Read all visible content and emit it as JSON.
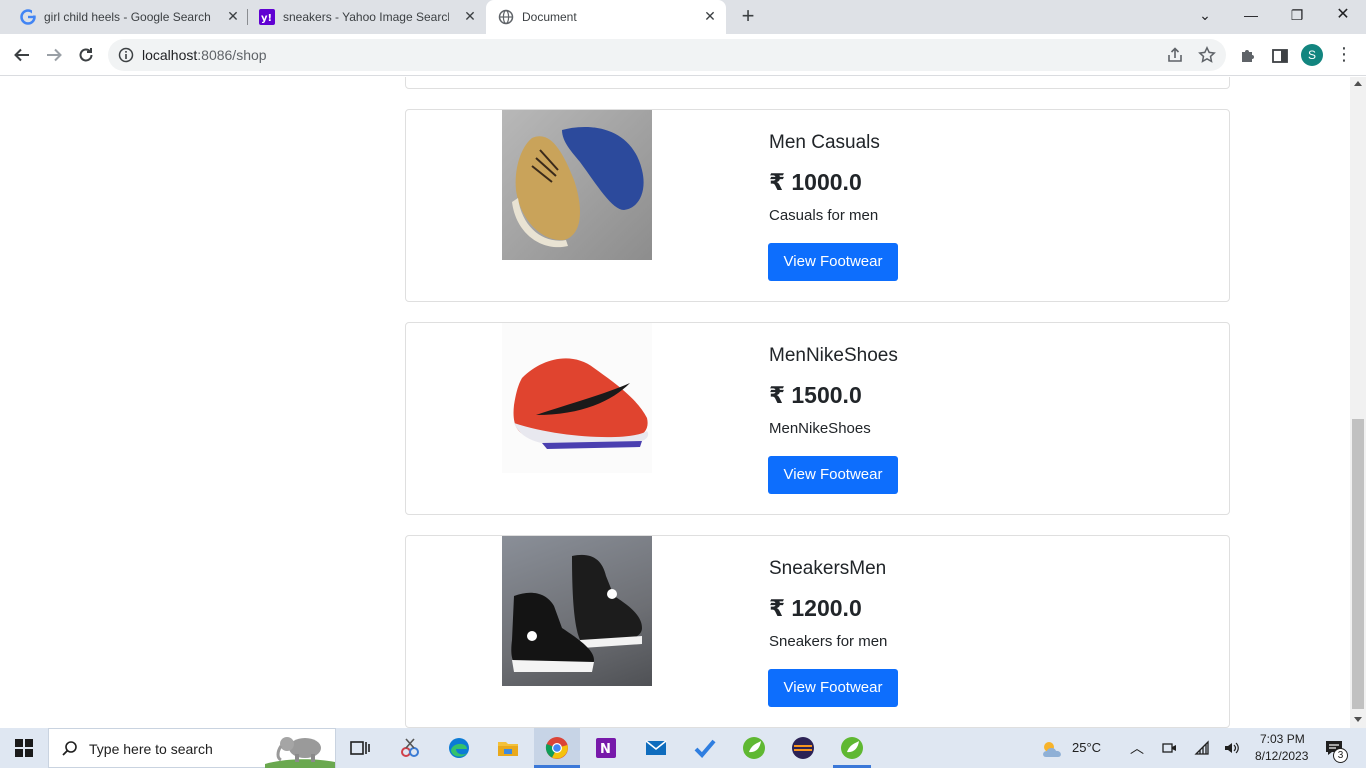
{
  "browser": {
    "tabs": [
      {
        "title": "girl child heels - Google Search",
        "favicon": "google-icon"
      },
      {
        "title": "sneakers - Yahoo Image Search R",
        "favicon": "yahoo-icon"
      },
      {
        "title": "Document",
        "favicon": "globe-icon"
      }
    ],
    "address": {
      "host": "localhost",
      "rest": ":8086/shop"
    },
    "profile_initial": "S"
  },
  "products": [
    {
      "name": "Men Casuals",
      "price": "₹ 1000.0",
      "description": "Casuals for men",
      "button": "View Footwear",
      "image": "casual-shoes-image"
    },
    {
      "name": "MenNikeShoes",
      "price": "₹ 1500.0",
      "description": "MenNikeShoes",
      "button": "View Footwear",
      "image": "nike-shoe-image"
    },
    {
      "name": "SneakersMen",
      "price": "₹ 1200.0",
      "description": "Sneakers for men",
      "button": "View Footwear",
      "image": "sneakers-image"
    }
  ],
  "taskbar": {
    "search_placeholder": "Type here to search",
    "weather": "25°C",
    "time": "7:03 PM",
    "date": "8/12/2023",
    "notification_count": "3"
  },
  "colors": {
    "accent": "#0d6efd",
    "tabstrip": "#dee1e6",
    "taskbar": "#dfe7f2"
  }
}
